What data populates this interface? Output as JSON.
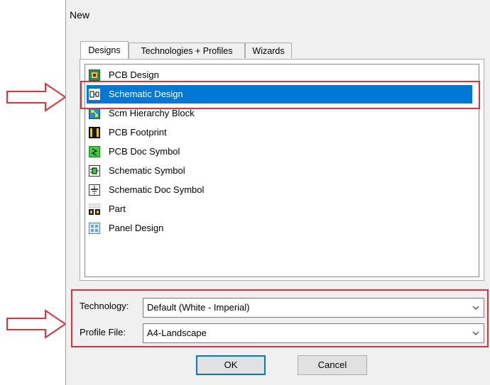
{
  "dialog": {
    "title": "New"
  },
  "tabs": [
    {
      "label": "Designs",
      "active": true
    },
    {
      "label": "Technologies + Profiles",
      "active": false
    },
    {
      "label": "Wizards",
      "active": false
    }
  ],
  "designs": [
    {
      "label": "PCB Design",
      "icon": "pcb-design-icon",
      "selected": false
    },
    {
      "label": "Schematic Design",
      "icon": "schematic-design-icon",
      "selected": true
    },
    {
      "label": "Scm Hierarchy Block",
      "icon": "hierarchy-block-icon",
      "selected": false
    },
    {
      "label": "PCB Footprint",
      "icon": "pcb-footprint-icon",
      "selected": false
    },
    {
      "label": "PCB Doc Symbol",
      "icon": "pcb-doc-symbol-icon",
      "selected": false
    },
    {
      "label": "Schematic Symbol",
      "icon": "schematic-symbol-icon",
      "selected": false
    },
    {
      "label": "Schematic Doc Symbol",
      "icon": "schematic-doc-symbol-icon",
      "selected": false
    },
    {
      "label": "Part",
      "icon": "part-icon",
      "selected": false
    },
    {
      "label": "Panel Design",
      "icon": "panel-design-icon",
      "selected": false
    }
  ],
  "technology": {
    "label": "Technology:",
    "value": "Default (White - Imperial)"
  },
  "profile": {
    "label": "Profile File:",
    "value": "A4-Landscape"
  },
  "buttons": {
    "ok": "OK",
    "cancel": "Cancel"
  },
  "colors": {
    "selection": "#0078d7",
    "highlight": "#e0303a",
    "dialog_bg": "#f0f0f0"
  }
}
